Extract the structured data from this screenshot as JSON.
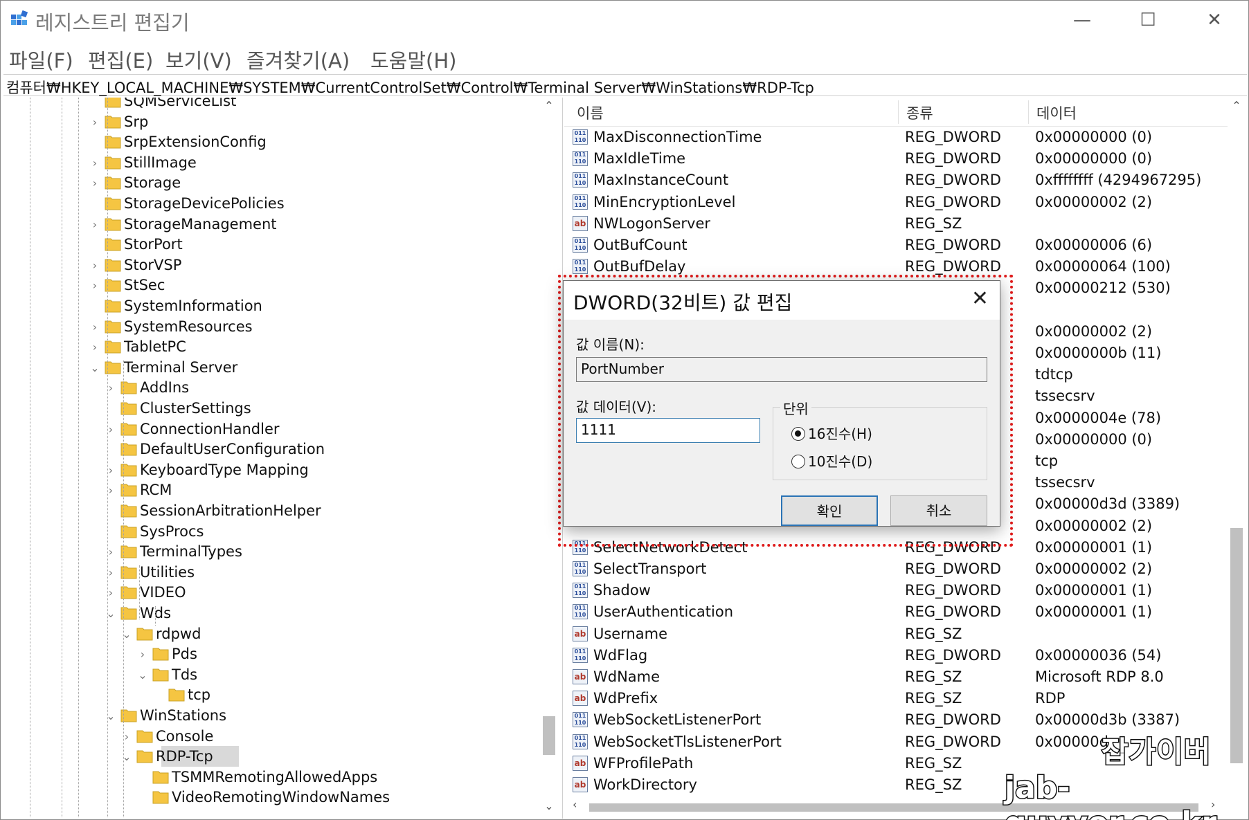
{
  "window": {
    "title": "레지스트리 편집기",
    "minimize": "—",
    "maximize": "☐",
    "close": "✕"
  },
  "menu": [
    "파일(F)",
    "편집(E)",
    "보기(V)",
    "즐겨찾기(A)",
    "도움말(H)"
  ],
  "address": "컴퓨터₩HKEY_LOCAL_MACHINE₩SYSTEM₩CurrentControlSet₩Control₩Terminal Server₩WinStations₩RDP-Tcp",
  "tree": [
    {
      "label": "SQMServiceList",
      "level": 0,
      "expander": ""
    },
    {
      "label": "Srp",
      "level": 0,
      "expander": "›"
    },
    {
      "label": "SrpExtensionConfig",
      "level": 0,
      "expander": ""
    },
    {
      "label": "StillImage",
      "level": 0,
      "expander": "›"
    },
    {
      "label": "Storage",
      "level": 0,
      "expander": "›"
    },
    {
      "label": "StorageDevicePolicies",
      "level": 0,
      "expander": ""
    },
    {
      "label": "StorageManagement",
      "level": 0,
      "expander": "›"
    },
    {
      "label": "StorPort",
      "level": 0,
      "expander": ""
    },
    {
      "label": "StorVSP",
      "level": 0,
      "expander": "›"
    },
    {
      "label": "StSec",
      "level": 0,
      "expander": "›"
    },
    {
      "label": "SystemInformation",
      "level": 0,
      "expander": ""
    },
    {
      "label": "SystemResources",
      "level": 0,
      "expander": "›"
    },
    {
      "label": "TabletPC",
      "level": 0,
      "expander": "›"
    },
    {
      "label": "Terminal Server",
      "level": 0,
      "expander": "⌄"
    },
    {
      "label": "AddIns",
      "level": 1,
      "expander": "›"
    },
    {
      "label": "ClusterSettings",
      "level": 1,
      "expander": ""
    },
    {
      "label": "ConnectionHandler",
      "level": 1,
      "expander": "›"
    },
    {
      "label": "DefaultUserConfiguration",
      "level": 1,
      "expander": ""
    },
    {
      "label": "KeyboardType Mapping",
      "level": 1,
      "expander": "›"
    },
    {
      "label": "RCM",
      "level": 1,
      "expander": "›"
    },
    {
      "label": "SessionArbitrationHelper",
      "level": 1,
      "expander": ""
    },
    {
      "label": "SysProcs",
      "level": 1,
      "expander": ""
    },
    {
      "label": "TerminalTypes",
      "level": 1,
      "expander": "›"
    },
    {
      "label": "Utilities",
      "level": 1,
      "expander": "›"
    },
    {
      "label": "VIDEO",
      "level": 1,
      "expander": "›"
    },
    {
      "label": "Wds",
      "level": 1,
      "expander": "⌄"
    },
    {
      "label": "rdpwd",
      "level": 2,
      "expander": "⌄"
    },
    {
      "label": "Pds",
      "level": 3,
      "expander": "›"
    },
    {
      "label": "Tds",
      "level": 3,
      "expander": "⌄"
    },
    {
      "label": "tcp",
      "level": 4,
      "expander": ""
    },
    {
      "label": "WinStations",
      "level": 1,
      "expander": "⌄"
    },
    {
      "label": "Console",
      "level": 2,
      "expander": "›"
    },
    {
      "label": "RDP-Tcp",
      "level": 2,
      "expander": "⌄",
      "selected": true
    },
    {
      "label": "TSMMRemotingAllowedApps",
      "level": 3,
      "expander": ""
    },
    {
      "label": "VideoRemotingWindowNames",
      "level": 3,
      "expander": ""
    }
  ],
  "list": {
    "columns": {
      "name": "이름",
      "type": "종류",
      "data": "데이터"
    },
    "rows": [
      {
        "name": "MaxDisconnectionTime",
        "type": "REG_DWORD",
        "data": "0x00000000 (0)",
        "kind": "dword"
      },
      {
        "name": "MaxIdleTime",
        "type": "REG_DWORD",
        "data": "0x00000000 (0)",
        "kind": "dword"
      },
      {
        "name": "MaxInstanceCount",
        "type": "REG_DWORD",
        "data": "0xffffffff (4294967295)",
        "kind": "dword"
      },
      {
        "name": "MinEncryptionLevel",
        "type": "REG_DWORD",
        "data": "0x00000002 (2)",
        "kind": "dword"
      },
      {
        "name": "NWLogonServer",
        "type": "REG_SZ",
        "data": "",
        "kind": "sz"
      },
      {
        "name": "OutBufCount",
        "type": "REG_DWORD",
        "data": "0x00000006 (6)",
        "kind": "dword"
      },
      {
        "name": "OutBufDelay",
        "type": "REG_DWORD",
        "data": "0x00000064 (100)",
        "kind": "dword"
      },
      {
        "name": "",
        "type": "",
        "data": "0x00000212 (530)",
        "kind": "none"
      },
      {
        "name": "",
        "type": "",
        "data": "",
        "kind": "none"
      },
      {
        "name": "",
        "type": "",
        "data": "0x00000002 (2)",
        "kind": "none"
      },
      {
        "name": "",
        "type": "",
        "data": "0x0000000b (11)",
        "kind": "none"
      },
      {
        "name": "",
        "type": "",
        "data": "tdtcp",
        "kind": "none"
      },
      {
        "name": "",
        "type": "",
        "data": "tssecsrv",
        "kind": "none"
      },
      {
        "name": "",
        "type": "",
        "data": "0x0000004e (78)",
        "kind": "none"
      },
      {
        "name": "",
        "type": "",
        "data": "0x00000000 (0)",
        "kind": "none"
      },
      {
        "name": "",
        "type": "",
        "data": "tcp",
        "kind": "none"
      },
      {
        "name": "",
        "type": "",
        "data": "tssecsrv",
        "kind": "none"
      },
      {
        "name": "",
        "type": "",
        "data": "0x00000d3d (3389)",
        "kind": "none"
      },
      {
        "name": "",
        "type": "",
        "data": "0x00000002 (2)",
        "kind": "none"
      },
      {
        "name": "SelectNetworkDetect",
        "type": "REG_DWORD",
        "data": "0x00000001 (1)",
        "kind": "dword"
      },
      {
        "name": "SelectTransport",
        "type": "REG_DWORD",
        "data": "0x00000002 (2)",
        "kind": "dword"
      },
      {
        "name": "Shadow",
        "type": "REG_DWORD",
        "data": "0x00000001 (1)",
        "kind": "dword"
      },
      {
        "name": "UserAuthentication",
        "type": "REG_DWORD",
        "data": "0x00000001 (1)",
        "kind": "dword"
      },
      {
        "name": "Username",
        "type": "REG_SZ",
        "data": "",
        "kind": "sz"
      },
      {
        "name": "WdFlag",
        "type": "REG_DWORD",
        "data": "0x00000036 (54)",
        "kind": "dword"
      },
      {
        "name": "WdName",
        "type": "REG_SZ",
        "data": "Microsoft RDP 8.0",
        "kind": "sz"
      },
      {
        "name": "WdPrefix",
        "type": "REG_SZ",
        "data": "RDP",
        "kind": "sz"
      },
      {
        "name": "WebSocketListenerPort",
        "type": "REG_DWORD",
        "data": "0x00000d3b (3387)",
        "kind": "dword"
      },
      {
        "name": "WebSocketTlsListenerPort",
        "type": "REG_DWORD",
        "data": "0x00000d",
        "kind": "dword"
      },
      {
        "name": "WFProfilePath",
        "type": "REG_SZ",
        "data": "",
        "kind": "sz"
      },
      {
        "name": "WorkDirectory",
        "type": "REG_SZ",
        "data": "",
        "kind": "sz"
      }
    ]
  },
  "dialog": {
    "title": "DWORD(32비트) 값 편집",
    "close": "✕",
    "value_name_label": "값 이름(N):",
    "value_name": "PortNumber",
    "value_data_label": "값 데이터(V):",
    "value_data": "1111",
    "base_label": "단위",
    "hex_label": "16진수(H)",
    "dec_label": "10진수(D)",
    "ok": "확인",
    "cancel": "취소"
  },
  "icons": {
    "dword": "011\n110",
    "sz": "ab"
  },
  "watermark": {
    "name": "잡가이버",
    "url": "jab-guyver.co.kr"
  },
  "colors": {
    "folder": "#f5c542",
    "highlight": "#e01b1b",
    "selection": "#d9d9d9",
    "focus": "#2a73b5"
  }
}
